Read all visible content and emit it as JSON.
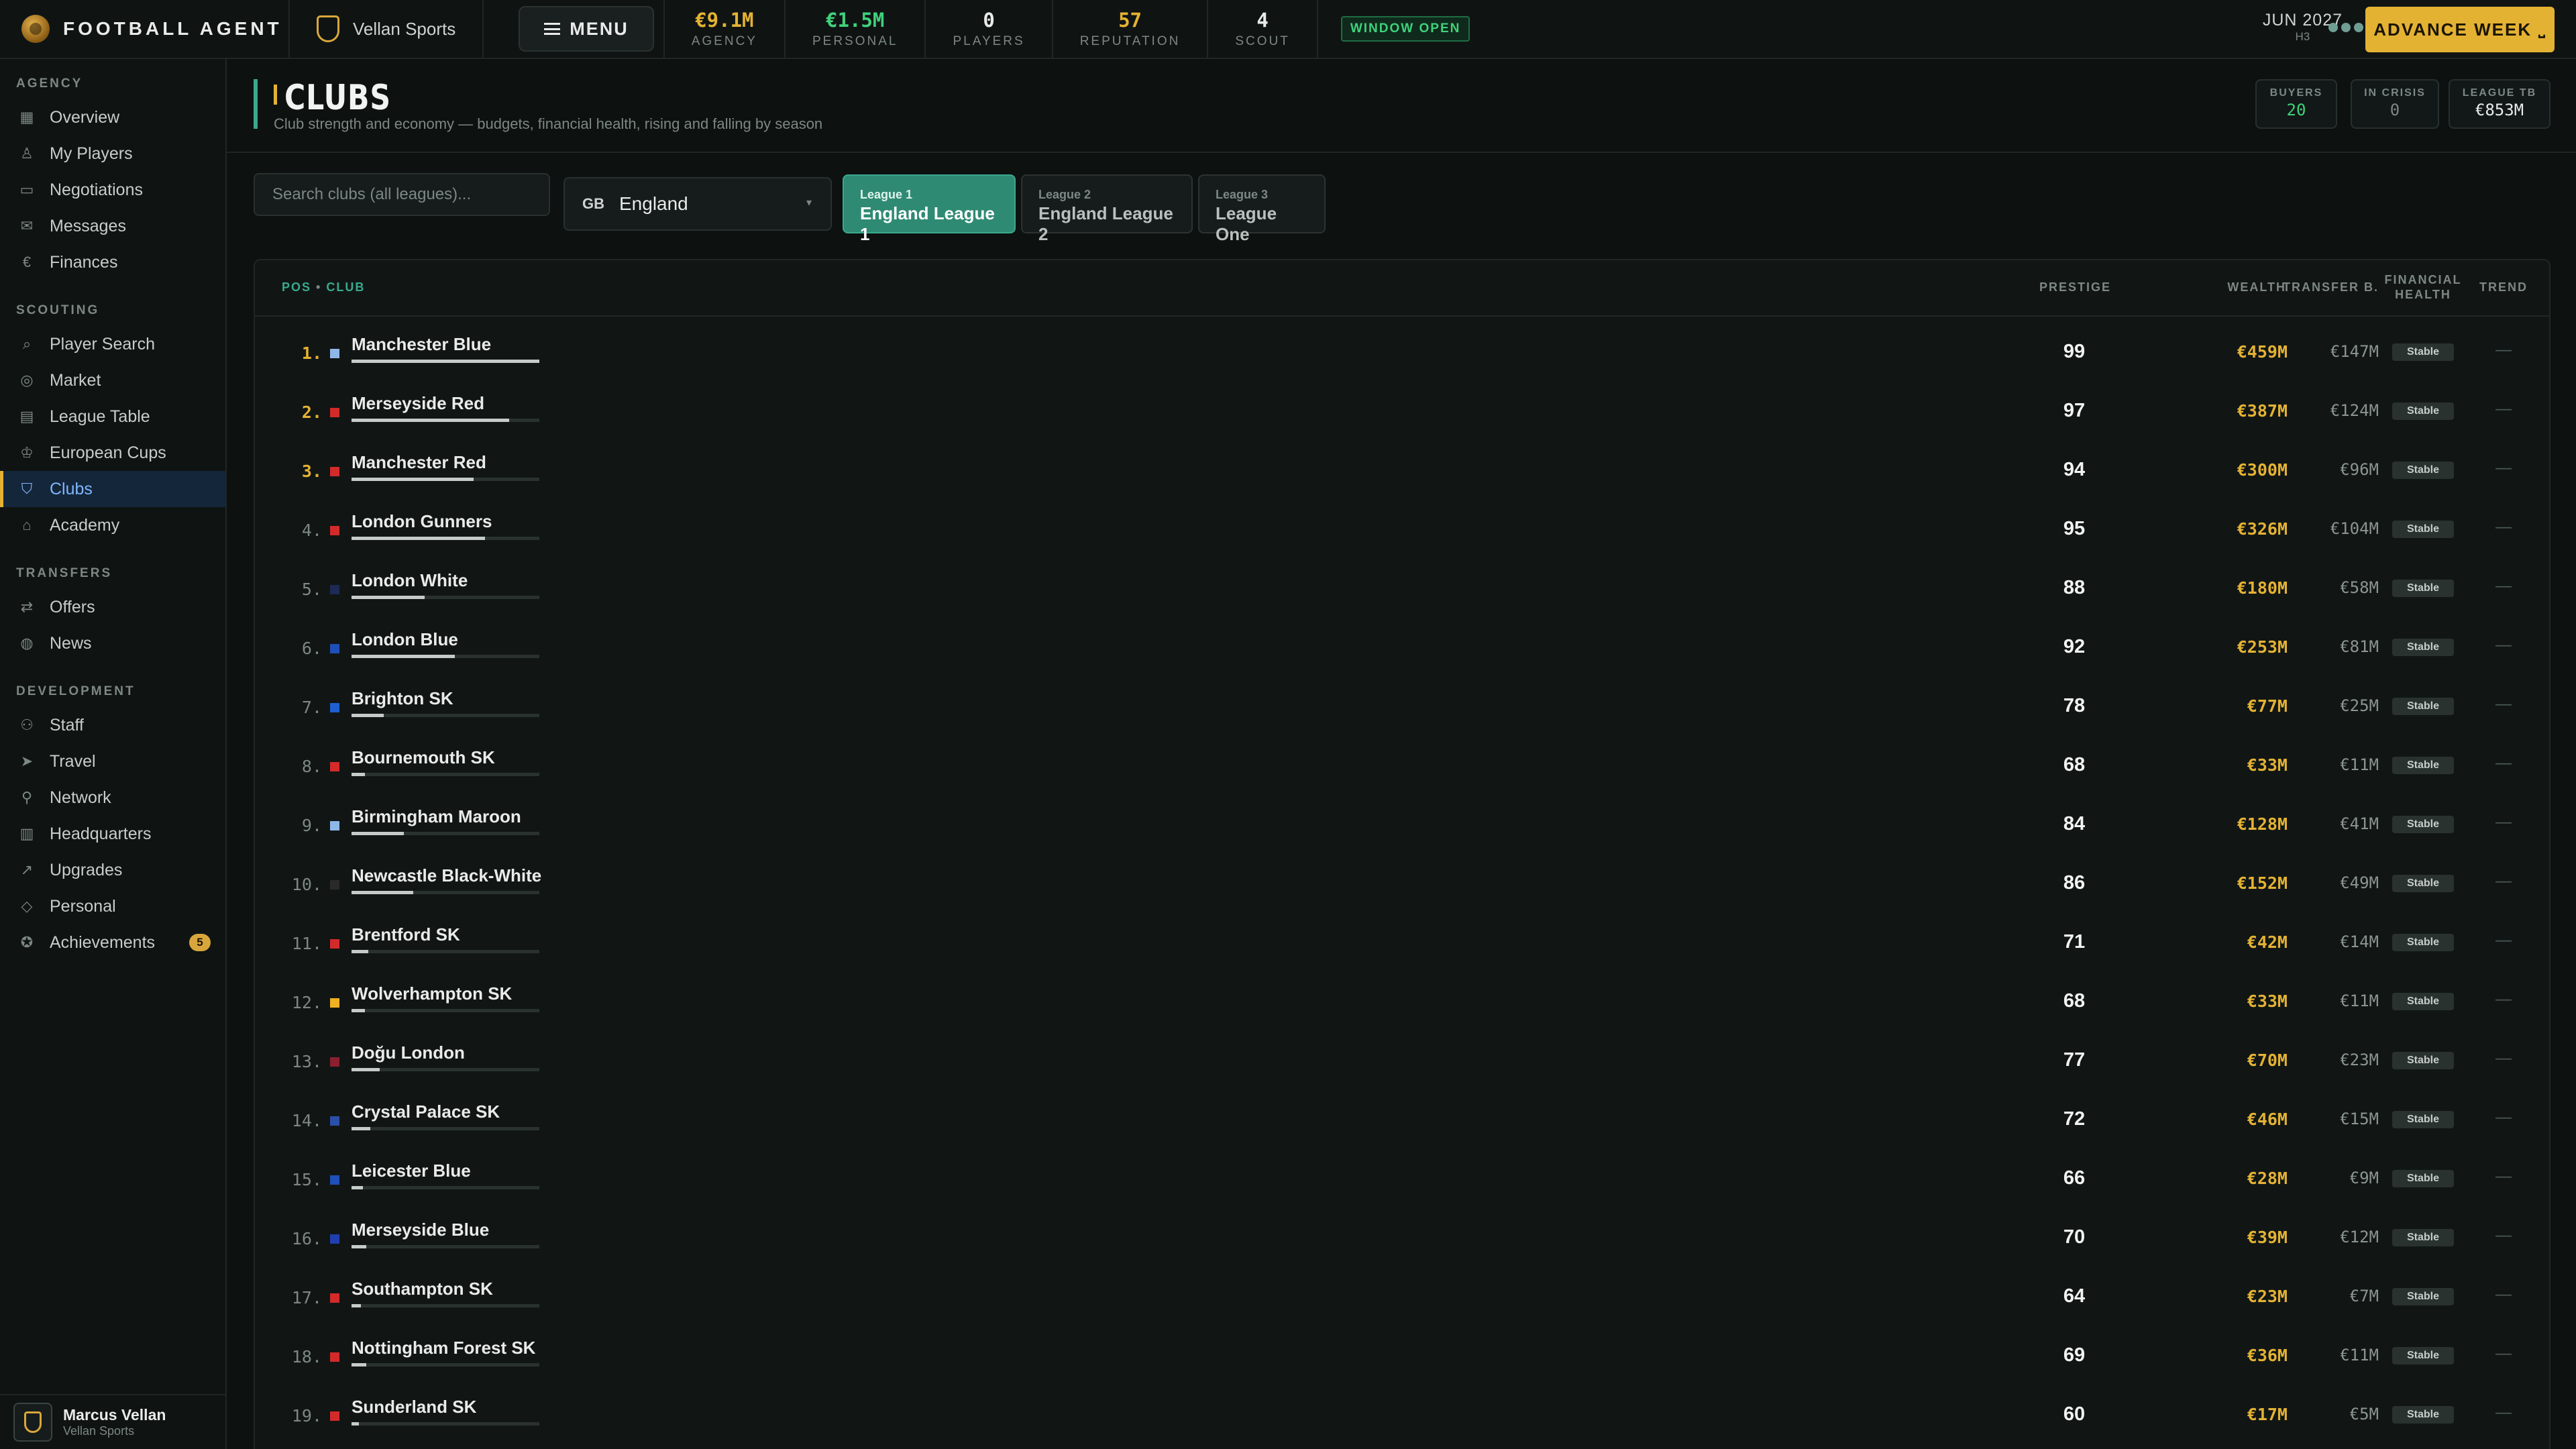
{
  "topbar": {
    "brand": "FOOTBALL AGENT",
    "agency_name": "Vellan Sports",
    "menu_label": "MENU",
    "stats": [
      {
        "value": "€9.1M",
        "label": "AGENCY",
        "color": "#e4b233"
      },
      {
        "value": "€1.5M",
        "label": "PERSONAL",
        "color": "#3fd27b"
      },
      {
        "value": "0",
        "label": "PLAYERS",
        "color": "#e8ebe9"
      },
      {
        "value": "57",
        "label": "REPUTATION",
        "color": "#e4b233"
      },
      {
        "value": "4",
        "label": "SCOUT",
        "color": "#e8ebe9"
      }
    ],
    "window_status": "WINDOW OPEN",
    "date": "JUN 2027",
    "date_sub": "H3",
    "advance_label": "ADVANCE WEEK",
    "advance_key": "⎵"
  },
  "sidebar": {
    "sections": [
      {
        "title": "AGENCY",
        "items": [
          {
            "label": "Overview",
            "icon": "grid-icon"
          },
          {
            "label": "My Players",
            "icon": "user-icon"
          },
          {
            "label": "Negotiations",
            "icon": "chat-icon"
          },
          {
            "label": "Messages",
            "icon": "mail-icon"
          },
          {
            "label": "Finances",
            "icon": "euro-icon"
          }
        ]
      },
      {
        "title": "SCOUTING",
        "items": [
          {
            "label": "Player Search",
            "icon": "search-icon"
          },
          {
            "label": "Market",
            "icon": "broadcast-icon"
          },
          {
            "label": "League Table",
            "icon": "table-icon"
          },
          {
            "label": "European Cups",
            "icon": "trophy-icon"
          },
          {
            "label": "Clubs",
            "icon": "shield-icon"
          },
          {
            "label": "Academy",
            "icon": "graduation-icon"
          }
        ]
      },
      {
        "title": "TRANSFERS",
        "items": [
          {
            "label": "Offers",
            "icon": "swap-icon"
          },
          {
            "label": "News",
            "icon": "globe-icon"
          }
        ]
      },
      {
        "title": "DEVELOPMENT",
        "items": [
          {
            "label": "Staff",
            "icon": "people-icon"
          },
          {
            "label": "Travel",
            "icon": "plane-icon"
          },
          {
            "label": "Network",
            "icon": "network-icon"
          },
          {
            "label": "Headquarters",
            "icon": "building-icon"
          },
          {
            "label": "Upgrades",
            "icon": "trend-up-icon"
          },
          {
            "label": "Personal",
            "icon": "diamond-icon"
          },
          {
            "label": "Achievements",
            "icon": "medal-icon",
            "badge": "5"
          }
        ]
      }
    ],
    "active": "Clubs",
    "user": {
      "name": "Marcus Vellan",
      "agency": "Vellan Sports"
    }
  },
  "page": {
    "title": "CLUBS",
    "subtitle": "Club strength and economy — budgets, financial health, rising and falling by season",
    "kpis": [
      {
        "label": "BUYERS",
        "value": "20",
        "color": "#3fd27b"
      },
      {
        "label": "IN CRISIS",
        "value": "0",
        "color": "#7d8784"
      },
      {
        "label": "LEAGUE TB",
        "value": "€853M",
        "color": "#e8ebe9"
      }
    ]
  },
  "filters": {
    "search_placeholder": "Search clubs (all leagues)...",
    "country_code": "GB",
    "country": "England",
    "leagues": [
      {
        "small": "League 1",
        "name": "England League 1"
      },
      {
        "small": "League 2",
        "name": "England League 2"
      },
      {
        "small": "League 3",
        "name": "League One"
      }
    ]
  },
  "table": {
    "headers": {
      "pos": "POS",
      "club": "CLUB",
      "prestige": "PRESTIGE",
      "wealth": "WEALTH",
      "transfer": "TRANSFER B.",
      "health_1": "FINANCIAL",
      "health_2": "HEALTH",
      "trend": "TREND"
    },
    "rows": [
      {
        "pos": "1.",
        "name": "Manchester Blue",
        "color": "#8fb8e8",
        "bar": 1.0,
        "prestige": "99",
        "wealth": "€459M",
        "tb": "€147M",
        "health": "Stable",
        "trend": "—"
      },
      {
        "pos": "2.",
        "name": "Merseyside Red",
        "color": "#d42a2a",
        "bar": 0.84,
        "prestige": "97",
        "wealth": "€387M",
        "tb": "€124M",
        "health": "Stable",
        "trend": "—"
      },
      {
        "pos": "3.",
        "name": "Manchester Red",
        "color": "#d42a2a",
        "bar": 0.65,
        "prestige": "94",
        "wealth": "€300M",
        "tb": "€96M",
        "health": "Stable",
        "trend": "—"
      },
      {
        "pos": "4.",
        "name": "London Gunners",
        "color": "#d42a2a",
        "bar": 0.71,
        "prestige": "95",
        "wealth": "€326M",
        "tb": "€104M",
        "health": "Stable",
        "trend": "—"
      },
      {
        "pos": "5.",
        "name": "London White",
        "color": "#1c2a55",
        "bar": 0.39,
        "prestige": "88",
        "wealth": "€180M",
        "tb": "€58M",
        "health": "Stable",
        "trend": "—"
      },
      {
        "pos": "6.",
        "name": "London Blue",
        "color": "#1f4fb8",
        "bar": 0.55,
        "prestige": "92",
        "wealth": "€253M",
        "tb": "€81M",
        "health": "Stable",
        "trend": "—"
      },
      {
        "pos": "7.",
        "name": "Brighton SK",
        "color": "#1f5fd0",
        "bar": 0.17,
        "prestige": "78",
        "wealth": "€77M",
        "tb": "€25M",
        "health": "Stable",
        "trend": "—"
      },
      {
        "pos": "8.",
        "name": "Bournemouth SK",
        "color": "#d42a2a",
        "bar": 0.07,
        "prestige": "68",
        "wealth": "€33M",
        "tb": "€11M",
        "health": "Stable",
        "trend": "—"
      },
      {
        "pos": "9.",
        "name": "Birmingham Maroon",
        "color": "#8fb8e8",
        "bar": 0.28,
        "prestige": "84",
        "wealth": "€128M",
        "tb": "€41M",
        "health": "Stable",
        "trend": "—"
      },
      {
        "pos": "10.",
        "name": "Newcastle Black-White",
        "color": "#2a2a2a",
        "bar": 0.33,
        "prestige": "86",
        "wealth": "€152M",
        "tb": "€49M",
        "health": "Stable",
        "trend": "—"
      },
      {
        "pos": "11.",
        "name": "Brentford SK",
        "color": "#d42a2a",
        "bar": 0.09,
        "prestige": "71",
        "wealth": "€42M",
        "tb": "€14M",
        "health": "Stable",
        "trend": "—"
      },
      {
        "pos": "12.",
        "name": "Wolverhampton SK",
        "color": "#f0b020",
        "bar": 0.07,
        "prestige": "68",
        "wealth": "€33M",
        "tb": "€11M",
        "health": "Stable",
        "trend": "—"
      },
      {
        "pos": "13.",
        "name": "Doğu London",
        "color": "#8a2030",
        "bar": 0.15,
        "prestige": "77",
        "wealth": "€70M",
        "tb": "€23M",
        "health": "Stable",
        "trend": "—"
      },
      {
        "pos": "14.",
        "name": "Crystal Palace SK",
        "color": "#2a4fa8",
        "bar": 0.1,
        "prestige": "72",
        "wealth": "€46M",
        "tb": "€15M",
        "health": "Stable",
        "trend": "—"
      },
      {
        "pos": "15.",
        "name": "Leicester Blue",
        "color": "#1f4fb8",
        "bar": 0.06,
        "prestige": "66",
        "wealth": "€28M",
        "tb": "€9M",
        "health": "Stable",
        "trend": "—"
      },
      {
        "pos": "16.",
        "name": "Merseyside Blue",
        "color": "#1f3fb0",
        "bar": 0.08,
        "prestige": "70",
        "wealth": "€39M",
        "tb": "€12M",
        "health": "Stable",
        "trend": "—"
      },
      {
        "pos": "17.",
        "name": "Southampton SK",
        "color": "#d42a2a",
        "bar": 0.05,
        "prestige": "64",
        "wealth": "€23M",
        "tb": "€7M",
        "health": "Stable",
        "trend": "—"
      },
      {
        "pos": "18.",
        "name": "Nottingham Forest SK",
        "color": "#d42a2a",
        "bar": 0.08,
        "prestige": "69",
        "wealth": "€36M",
        "tb": "€11M",
        "health": "Stable",
        "trend": "—"
      },
      {
        "pos": "19.",
        "name": "Sunderland SK",
        "color": "#d42a2a",
        "bar": 0.04,
        "prestige": "60",
        "wealth": "€17M",
        "tb": "€5M",
        "health": "Stable",
        "trend": "—"
      }
    ]
  }
}
